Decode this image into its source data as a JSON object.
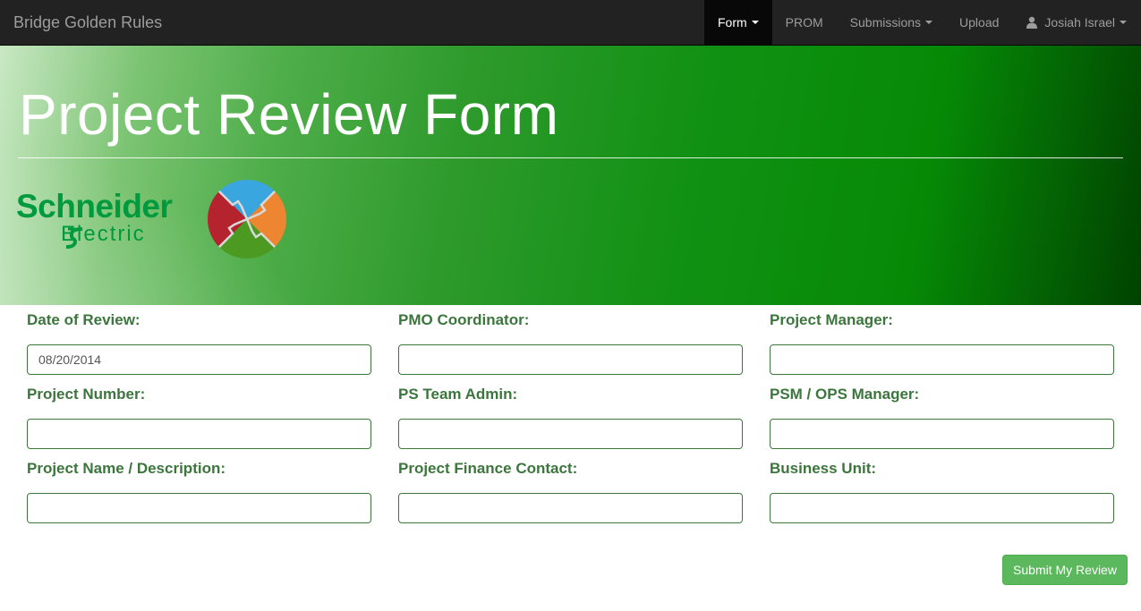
{
  "navbar": {
    "brand": "Bridge Golden Rules",
    "items": [
      {
        "label": "Form",
        "active": true,
        "dropdown": true
      },
      {
        "label": "PROM",
        "active": false,
        "dropdown": false
      },
      {
        "label": "Submissions",
        "active": false,
        "dropdown": true
      },
      {
        "label": "Upload",
        "active": false,
        "dropdown": false
      }
    ],
    "user": {
      "name": "Josiah Israel",
      "icon": "user-icon"
    }
  },
  "hero": {
    "title": "Project Review Form",
    "logo": {
      "line1": "Schneider",
      "line2": "Electric"
    }
  },
  "form": {
    "fields": [
      {
        "label": "Date of Review:",
        "value": "08/20/2014",
        "placeholder": ""
      },
      {
        "label": "PMO Coordinator:",
        "value": "",
        "placeholder": ""
      },
      {
        "label": "Project Manager:",
        "value": "",
        "placeholder": ""
      },
      {
        "label": "Project Number:",
        "value": "",
        "placeholder": ""
      },
      {
        "label": "PS Team Admin:",
        "value": "",
        "placeholder": ""
      },
      {
        "label": "PSM / OPS Manager:",
        "value": "",
        "placeholder": ""
      },
      {
        "label": "Project Name / Description:",
        "value": "",
        "placeholder": ""
      },
      {
        "label": "Project Finance Contact:",
        "value": "",
        "placeholder": ""
      },
      {
        "label": "Business Unit:",
        "value": "",
        "placeholder": ""
      }
    ],
    "submit_label": "Submit My Review"
  },
  "colors": {
    "navbar_bg": "#222222",
    "label_green": "#3c763d",
    "button_green": "#5cb85c",
    "brand_green": "#009a3e"
  }
}
